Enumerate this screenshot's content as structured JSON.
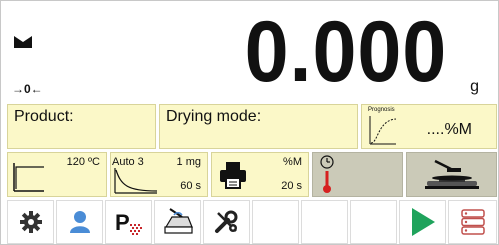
{
  "display": {
    "reading": "0.000",
    "unit": "g",
    "zero_indicator": "→0←",
    "stability_icon": "stable-weight-icon"
  },
  "info": {
    "product_label": "Product:",
    "drying_mode_label": "Drying mode:",
    "prognosis_label": "Prognosis",
    "prognosis_value": "....%M"
  },
  "params": {
    "drying_temp": "120 ºC",
    "finish_mode": "Auto 3",
    "finish_mass": "1 mg",
    "finish_time": "60 s",
    "print_unit": "%M",
    "print_interval": "20 s",
    "timer_icon": "timer-thermometer-icon",
    "pan_icon": "weighing-pan-icon"
  },
  "buttons": [
    {
      "name": "settings",
      "icon": "gear-icon"
    },
    {
      "name": "user",
      "icon": "user-icon"
    },
    {
      "name": "product",
      "icon": "product-database-icon"
    },
    {
      "name": "drying-profile",
      "icon": "drying-profile-icon"
    },
    {
      "name": "tools",
      "icon": "tools-icon"
    },
    {
      "name": "empty-1",
      "icon": ""
    },
    {
      "name": "empty-2",
      "icon": ""
    },
    {
      "name": "empty-3",
      "icon": ""
    },
    {
      "name": "start",
      "icon": "play-icon"
    },
    {
      "name": "database",
      "icon": "database-icon"
    }
  ],
  "colors": {
    "info_background": "#fbf8c8",
    "status_background": "#cbcab8",
    "start_green": "#1fa35c",
    "thermo_red": "#d62020",
    "user_blue": "#4a8cd6",
    "product_red": "#c8262b",
    "database_red": "#c0504d"
  }
}
